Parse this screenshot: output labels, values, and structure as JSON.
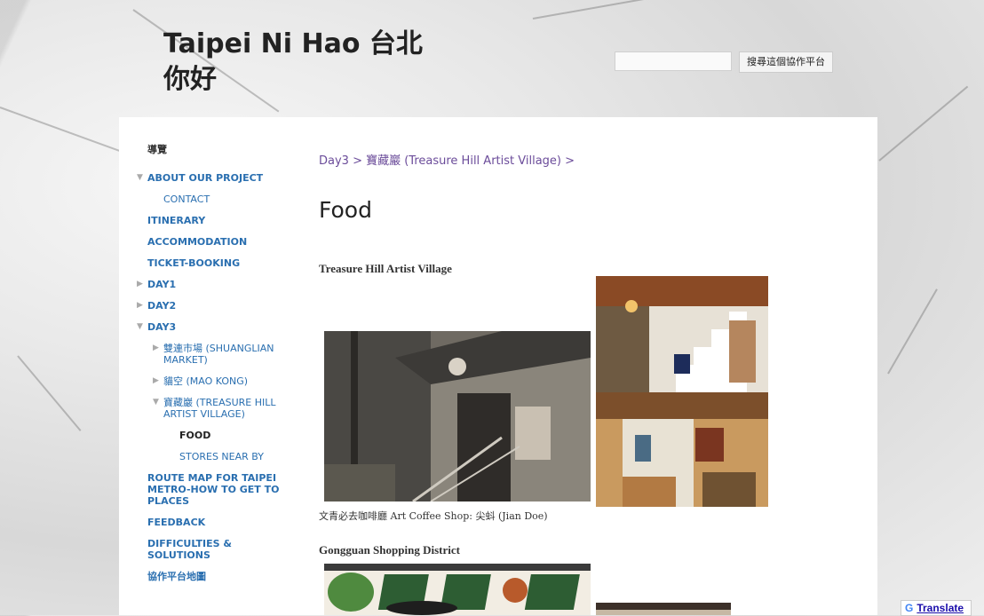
{
  "site": {
    "title": "Taipei Ni Hao 台北你好"
  },
  "search": {
    "placeholder": "",
    "button_label": "搜尋這個協作平台"
  },
  "nav": {
    "heading": "導覽",
    "items": [
      {
        "label": "ABOUT OUR PROJECT",
        "level": 0,
        "chevron": "▼"
      },
      {
        "label": "CONTACT",
        "level": 1,
        "chevron": ""
      },
      {
        "label": "ITINERARY",
        "level": 0,
        "chevron": ""
      },
      {
        "label": "ACCOMMODATION",
        "level": 0,
        "chevron": ""
      },
      {
        "label": "TICKET-BOOKING",
        "level": 0,
        "chevron": ""
      },
      {
        "label": "DAY1",
        "level": 0,
        "chevron": "▶"
      },
      {
        "label": "DAY2",
        "level": 0,
        "chevron": "▶"
      },
      {
        "label": "DAY3",
        "level": 0,
        "chevron": "▼"
      },
      {
        "label": "雙連市場 (SHUANGLIAN MARKET)",
        "level": 1,
        "chevron": "▶"
      },
      {
        "label": "貓空 (MAO KONG)",
        "level": 1,
        "chevron": "▶"
      },
      {
        "label": "寶藏巖 (TREASURE HILL ARTIST VILLAGE)",
        "level": 1,
        "chevron": "▼"
      },
      {
        "label": "FOOD",
        "level": 2,
        "chevron": "",
        "current": true
      },
      {
        "label": "STORES NEAR BY",
        "level": 2,
        "chevron": ""
      },
      {
        "label": "ROUTE MAP FOR TAIPEI METRO-HOW TO GET TO PLACES",
        "level": 0,
        "chevron": ""
      },
      {
        "label": "FEEDBACK",
        "level": 0,
        "chevron": ""
      },
      {
        "label": "DIFFICULTIES & SOLUTIONS",
        "level": 0,
        "chevron": ""
      },
      {
        "label": "協作平台地圖",
        "level": 0,
        "chevron": ""
      }
    ]
  },
  "main": {
    "breadcrumb": "Day3 > 寶藏巖 (Treasure Hill Artist Village) >",
    "page_title": "Food",
    "section1_heading": "Treasure Hill Artist Village",
    "photo_caption": "文青必去咖啡廳 Art Coffee Shop: 尖蚪 (Jian Doe)",
    "section2_heading": "Gongguan Shopping District"
  },
  "translate": {
    "label": "Translate"
  },
  "icons": {
    "google": "google-g-icon"
  },
  "colors": {
    "link": "#2a6fb0",
    "breadcrumb": "#6b4c9a"
  }
}
